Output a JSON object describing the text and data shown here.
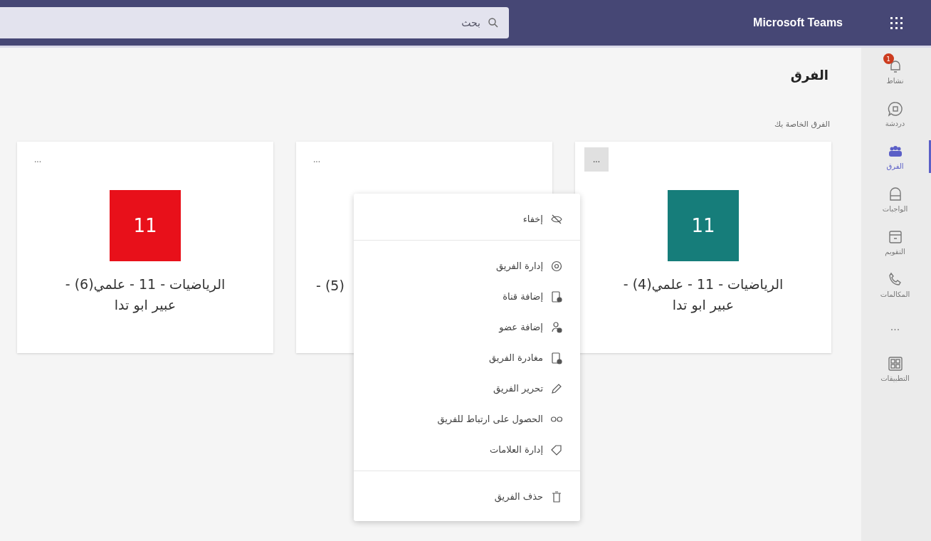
{
  "top_bar": {
    "app_title": "Microsoft Teams",
    "search": {
      "placeholder": "بحث"
    }
  },
  "rail": [
    {
      "label": "نشاط",
      "selected": false,
      "badge": "1"
    },
    {
      "label": "دردشة",
      "selected": false
    },
    {
      "label": "الفرق",
      "selected": true
    },
    {
      "label": "الواجبات",
      "selected": false
    },
    {
      "label": "التقويم",
      "selected": false
    },
    {
      "label": "المكالمات",
      "selected": false
    },
    {
      "label": "...",
      "kind": "more",
      "selected": false
    },
    {
      "label": "التطبيقات",
      "selected": false
    }
  ],
  "page": {
    "title": "الفرق",
    "section": "الفرق الخاصة بك"
  },
  "cards": [
    {
      "avatar": "11",
      "color": "#167d7a",
      "name": "الرياضيات - 11 - علمي(4) -\nعبير ابو تدا",
      "more": "...",
      "selected": true
    },
    {
      "name": "(5) -",
      "more": "...",
      "selected": false
    },
    {
      "avatar": "11",
      "color": "#e8101a",
      "name": "الرياضيات - 11 - علمي(6) -\nعبير ابو تدا",
      "more": "...",
      "selected": false
    }
  ],
  "menu": [
    [
      {
        "label": "إخفاء"
      }
    ],
    [
      {
        "label": "إدارة الفريق"
      },
      {
        "label": "إضافة قناة"
      },
      {
        "label": "إضافة عضو"
      },
      {
        "label": "مغادرة الفريق"
      },
      {
        "label": "تحرير الفريق"
      },
      {
        "label": "الحصول على ارتباط للفريق"
      },
      {
        "label": "إدارة العلامات"
      }
    ],
    [
      {
        "label": "حذف الفريق"
      }
    ]
  ]
}
